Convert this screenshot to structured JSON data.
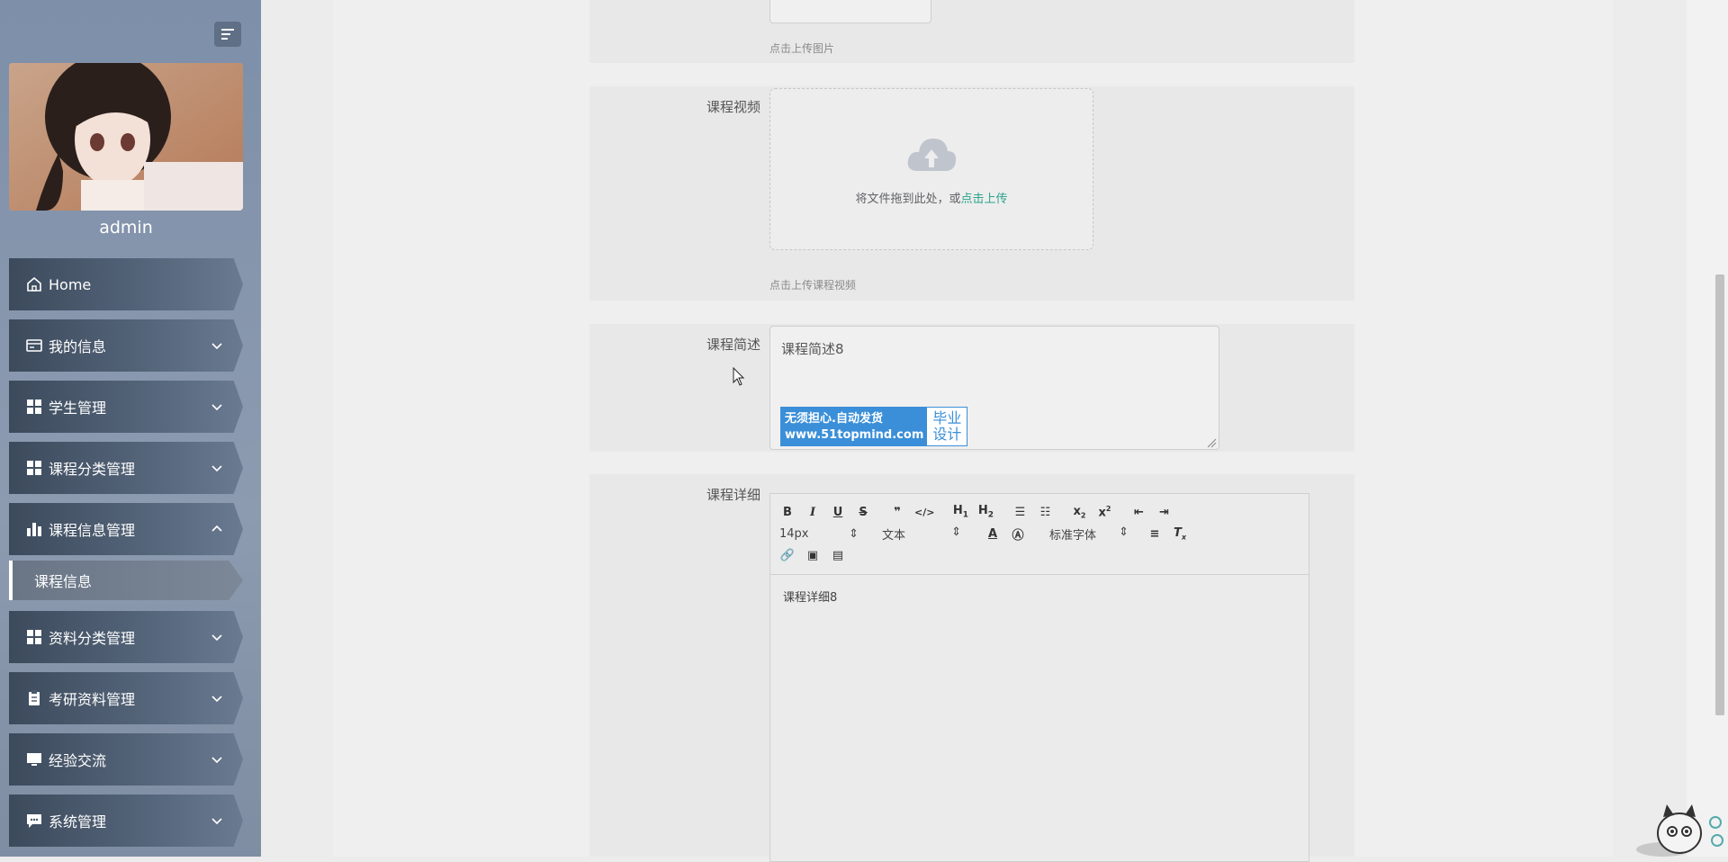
{
  "user": {
    "name": "admin"
  },
  "sidebar": {
    "items": [
      {
        "label": "Home",
        "icon": "home-icon",
        "expandable": false
      },
      {
        "label": "我的信息",
        "icon": "id-card-icon",
        "expandable": true
      },
      {
        "label": "学生管理",
        "icon": "grid-icon",
        "expandable": true
      },
      {
        "label": "课程分类管理",
        "icon": "grid-icon",
        "expandable": true
      },
      {
        "label": "课程信息管理",
        "icon": "bar-chart-icon",
        "expandable": true,
        "expanded": true
      },
      {
        "label": "资料分类管理",
        "icon": "grid-icon",
        "expandable": true
      },
      {
        "label": "考研资料管理",
        "icon": "clipboard-icon",
        "expandable": true
      },
      {
        "label": "经验交流",
        "icon": "monitor-icon",
        "expandable": true
      },
      {
        "label": "系统管理",
        "icon": "chat-icon",
        "expandable": true
      }
    ],
    "submenu": {
      "label": "课程信息"
    }
  },
  "form": {
    "image_hint": "点击上传图片",
    "video": {
      "label": "课程视频",
      "drop_text": "将文件拖到此处，或",
      "drop_link": "点击上传",
      "hint": "点击上传课程视频"
    },
    "summary": {
      "label": "课程简述",
      "value": "课程简述8"
    },
    "detail": {
      "label": "课程详细",
      "font_size": "14px",
      "block_type": "文本",
      "font_family": "标准字体",
      "value": "课程详细8"
    }
  },
  "watermark": {
    "left_line1": "无须担心.自动发货",
    "left_line2": "www.51topmind.com",
    "right_line1": "毕业",
    "right_line2": "设计"
  },
  "colors": {
    "accent": "#2aa38a",
    "sidebar": "#7d8fa9",
    "watermark_blue": "#3a8fd8"
  }
}
